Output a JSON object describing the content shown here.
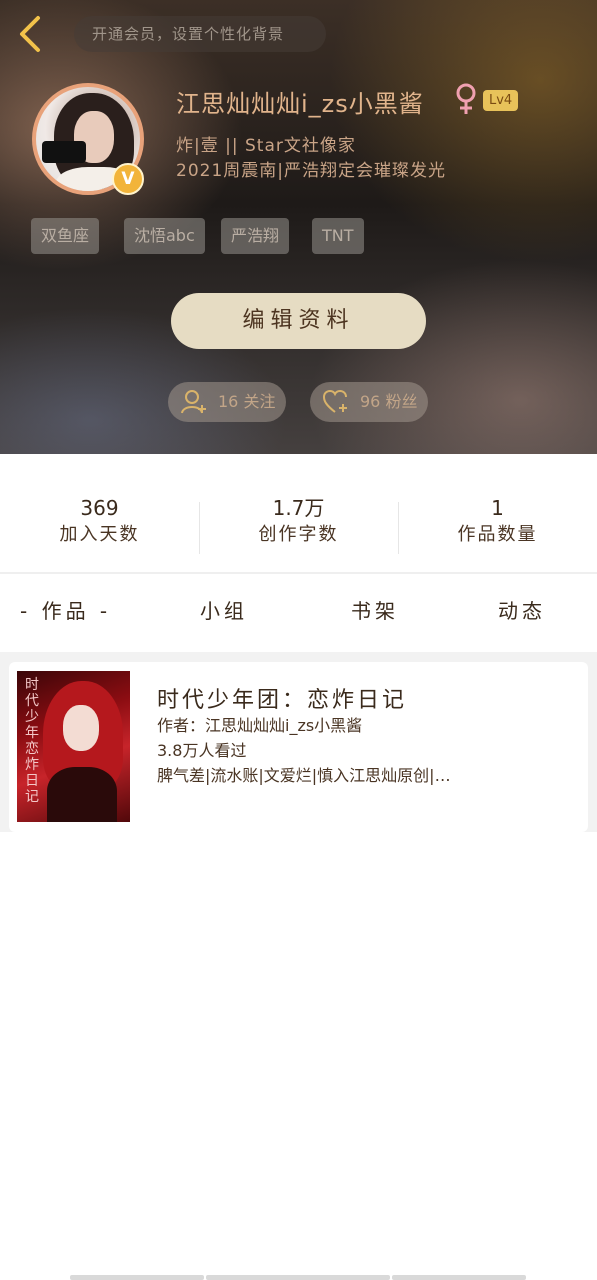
{
  "header": {
    "vip_tip": "开通会员，设置个性化背景",
    "username": "江思灿灿灿i_zs小黑酱",
    "gender": "female",
    "level": "Lv4",
    "verified_badge": "V",
    "bio_line_1": "炸|壹 || Star文社像家",
    "bio_line_2": "2021周震南|严浩翔定会璀璨发光",
    "tags": [
      "双鱼座",
      "沈悟abc",
      "严浩翔",
      "TNT"
    ],
    "edit_button": "编辑资料",
    "follow_count": "16 关注",
    "fans_count": "96 粉丝"
  },
  "stats": [
    {
      "num": "369",
      "label": "加入天数"
    },
    {
      "num": "1.7万",
      "label": "创作字数"
    },
    {
      "num": "1",
      "label": "作品数量"
    }
  ],
  "tabs": [
    "- 作品 -",
    "小组",
    "书架",
    "动态"
  ],
  "works": [
    {
      "title": "时代少年团：恋炸日记",
      "author": "作者：江思灿灿灿i_zs小黑酱",
      "views": "3.8万人看过",
      "desc": "脾气差|流水账|文爱烂|慎入江思灿原创|…",
      "cover_text": "时代少年恋炸日记"
    }
  ],
  "colors": {
    "accent_gold": "#e1b48c",
    "button_bg": "#e6dcc3",
    "avatar_border": "#e8a27a",
    "level_badge": "#e8c25a"
  },
  "icons": {
    "back": "chevron-left-icon",
    "gender": "female-icon",
    "follow": "user-add-icon",
    "fans": "heart-add-icon"
  }
}
